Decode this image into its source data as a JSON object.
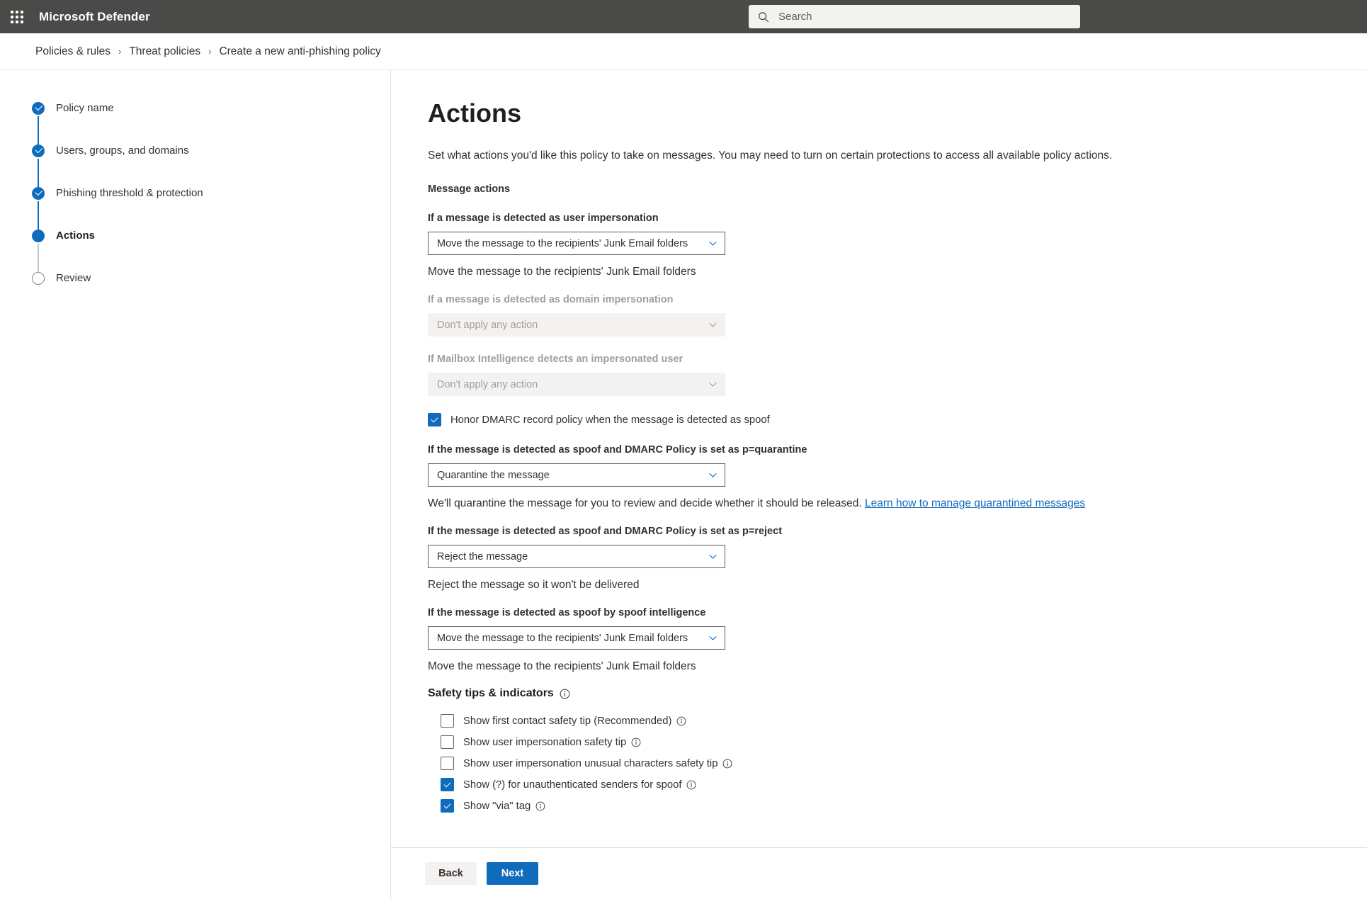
{
  "suite": {
    "app_launcher_icon": "waffle-icon",
    "title": "Microsoft Defender",
    "search": {
      "icon": "search-icon",
      "placeholder": "Search",
      "value": ""
    }
  },
  "breadcrumb": {
    "items": [
      {
        "label": "Policies & rules",
        "current": false
      },
      {
        "label": "Threat policies",
        "current": false
      },
      {
        "label": "Create a new anti-phishing policy",
        "current": true
      }
    ],
    "separator": "›"
  },
  "wizard": {
    "steps": [
      {
        "label": "Policy name",
        "state": "done"
      },
      {
        "label": "Users, groups, and domains",
        "state": "done"
      },
      {
        "label": "Phishing threshold & protection",
        "state": "done"
      },
      {
        "label": "Actions",
        "state": "active"
      },
      {
        "label": "Review",
        "state": "todo"
      }
    ]
  },
  "main": {
    "title": "Actions",
    "intro": "Set what actions you'd like this policy to take on messages. You may need to turn on certain protections to access all available policy actions.",
    "section_label": "Message actions",
    "fields": {
      "user_impersonation": {
        "label": "If a message is detected as user impersonation",
        "value": "Move the message to the recipients' Junk Email folders",
        "hint": "Move the message to the recipients' Junk Email folders",
        "disabled": false
      },
      "domain_impersonation": {
        "label": "If a message is detected as domain impersonation",
        "value": "Don't apply any action",
        "disabled": true
      },
      "mailbox_intelligence": {
        "label": "If Mailbox Intelligence detects an impersonated user",
        "value": "Don't apply any action",
        "disabled": true
      },
      "honor_dmarc": {
        "label": "Honor DMARC record policy when the message is detected as spoof",
        "checked": true
      },
      "dmarc_quarantine": {
        "label": "If the message is detected as spoof and DMARC Policy is set as p=quarantine",
        "value": "Quarantine the message",
        "hint_prefix": "We'll quarantine the message for you to review and decide whether it should be released. ",
        "hint_link": "Learn how to manage quarantined messages",
        "disabled": false
      },
      "dmarc_reject": {
        "label": "If the message is detected as spoof and DMARC Policy is set as p=reject",
        "value": "Reject the message",
        "hint": "Reject the message so it won't be delivered",
        "disabled": false
      },
      "spoof_intelligence": {
        "label": "If the message is detected as spoof by spoof intelligence",
        "value": "Move the message to the recipients' Junk Email folders",
        "hint": "Move the message to the recipients' Junk Email folders",
        "disabled": false
      }
    },
    "safety": {
      "heading": "Safety tips & indicators",
      "heading_info_icon": "info-icon",
      "items": [
        {
          "label": "Show first contact safety tip (Recommended)",
          "checked": false,
          "info_icon": "info-icon"
        },
        {
          "label": "Show user impersonation safety tip",
          "checked": false,
          "info_icon": "info-icon"
        },
        {
          "label": "Show user impersonation unusual characters safety tip",
          "checked": false,
          "info_icon": "info-icon"
        },
        {
          "label": "Show (?) for unauthenticated senders for spoof",
          "checked": true,
          "info_icon": "info-icon"
        },
        {
          "label": "Show \"via\" tag",
          "checked": true,
          "info_icon": "info-icon"
        }
      ]
    }
  },
  "footer": {
    "back_label": "Back",
    "next_label": "Next"
  },
  "colors": {
    "accent": "#0f6cbd",
    "suite_bar": "#4a4a48",
    "text": "#323130"
  }
}
